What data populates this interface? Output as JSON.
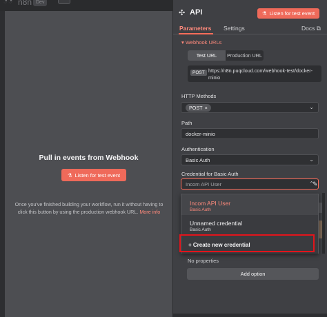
{
  "left": {
    "brand": "n8n",
    "badge": "Dev",
    "title": "Pull in events from Webhook",
    "listen_button": "Listen for test event",
    "description": "Once you've finished building your workflow, run it without having to click this button by using the production webhook URL.",
    "more_info": "More info"
  },
  "node": {
    "title": "API",
    "listen_button": "Listen for test event",
    "tabs": {
      "parameters": "Parameters",
      "settings": "Settings",
      "docs": "Docs"
    },
    "webhook_section": "Webhook URLs",
    "url_toggle": {
      "test": "Test URL",
      "production": "Production URL"
    },
    "url_method": "POST",
    "url": "https://n8n.puqcloud.com/webhook-test/docker-minio",
    "http_methods_label": "HTTP Methods",
    "http_method_value": "POST",
    "path_label": "Path",
    "path_value": "docker-minio",
    "auth_label": "Authentication",
    "auth_value": "Basic Auth",
    "credential_label": "Credential for Basic Auth",
    "credential_value": "Incom API User",
    "dropdown": [
      {
        "title": "Incom API User",
        "subtitle": "Basic Auth"
      },
      {
        "title": "Unnamed credential",
        "subtitle": "Basic Auth"
      }
    ],
    "create_credential": "Create new credential",
    "no_properties": "No properties",
    "add_option": "Add option"
  },
  "colors": {
    "accent": "#ff6d5a",
    "highlight_box": "#e3141b"
  }
}
